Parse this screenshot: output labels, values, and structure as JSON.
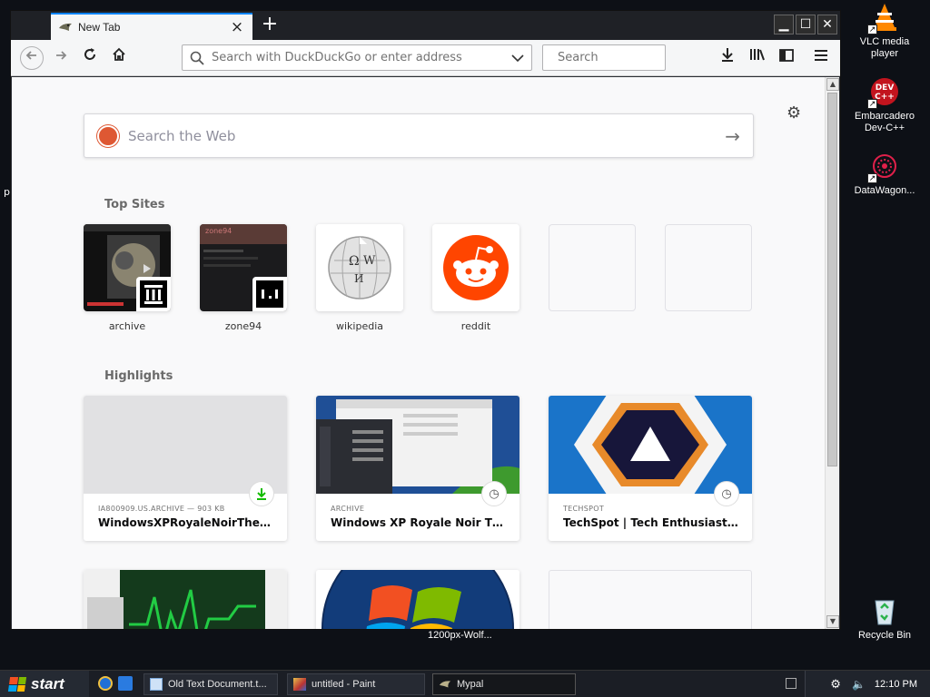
{
  "browser": {
    "tab": {
      "title": "New Tab",
      "close_label": "×"
    },
    "new_tab_label": "+",
    "url_placeholder": "Search with DuckDuckGo or enter address",
    "search_placeholder": "Search",
    "window_controls": {
      "minimize": "▁",
      "maximize": "☐",
      "close": "✕"
    }
  },
  "newtab": {
    "web_search_placeholder": "Search the Web",
    "top_sites_title": "Top Sites",
    "top_sites": [
      {
        "label": "archive"
      },
      {
        "label": "zone94"
      },
      {
        "label": "wikipedia"
      },
      {
        "label": "reddit"
      },
      {
        "label": ""
      },
      {
        "label": ""
      }
    ],
    "highlights_title": "Highlights",
    "highlights": [
      {
        "host": "IA800909.US.ARCHIVE — 903 KB",
        "title": "WindowsXPRoyaleNoirTheme.zip",
        "icon": "download-icon"
      },
      {
        "host": "ARCHIVE",
        "title": "Windows XP Royale Noir Theme ...",
        "icon": "clock-icon"
      },
      {
        "host": "TECHSPOT",
        "title": "TechSpot | Tech Enthusiasts, Po...",
        "icon": "clock-icon"
      }
    ]
  },
  "desktop": {
    "icons": [
      {
        "label": "VLC media player"
      },
      {
        "label": "Embarcadero Dev-C++"
      },
      {
        "label": "DataWagon..."
      },
      {
        "label": "Recycle Bin"
      }
    ],
    "partial_label": "1200px-Wolf..."
  },
  "taskbar": {
    "start_label": "start",
    "tasks": [
      {
        "label": "Old Text Document.t..."
      },
      {
        "label": "untitled - Paint"
      },
      {
        "label": "Mypal"
      }
    ],
    "clock": "12:10 PM"
  },
  "colors": {
    "accent": "#0a84ff",
    "reddit": "#ff4500",
    "ddg": "#de5833"
  }
}
